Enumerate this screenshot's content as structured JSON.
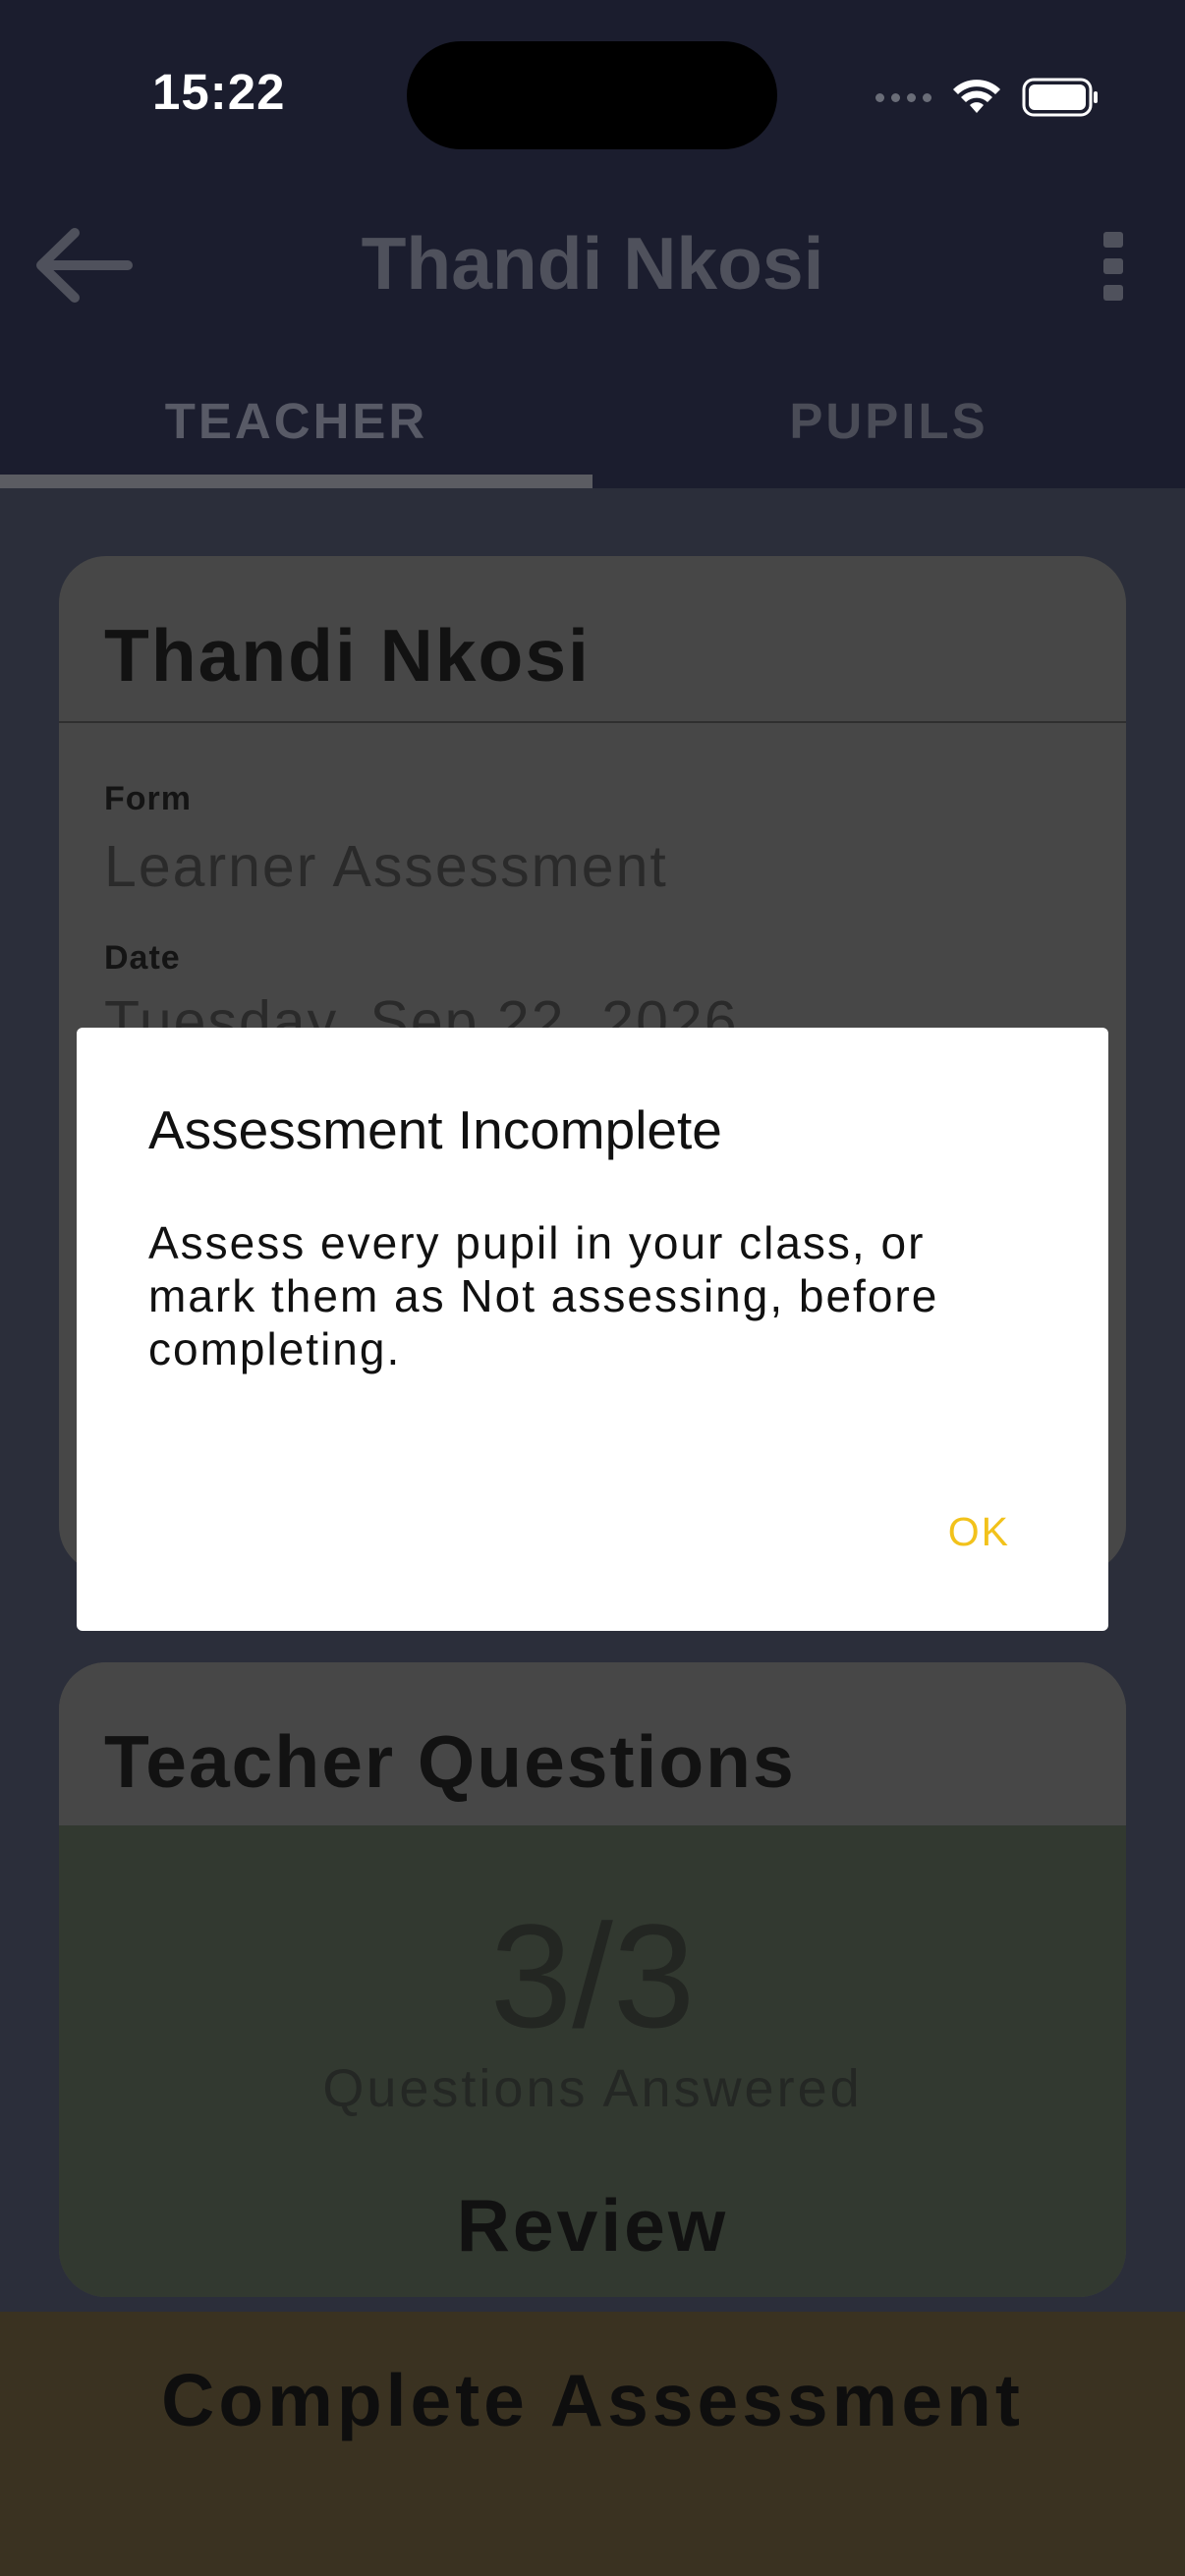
{
  "status_bar": {
    "time": "15:22"
  },
  "header": {
    "title": "Thandi Nkosi",
    "back_icon": "arrow-left-icon",
    "menu_icon": "more-vertical-icon"
  },
  "tabs": [
    {
      "label": "TEACHER",
      "selected": true
    },
    {
      "label": "PUPILS",
      "selected": false
    }
  ],
  "details_card": {
    "title": "Thandi Nkosi",
    "form_label": "Form",
    "form_value": "Learner Assessment",
    "date_label": "Date",
    "date_value": "Tuesday, Sep 22, 2026"
  },
  "questions_card": {
    "title": "Teacher Questions",
    "progress": "3/3",
    "progress_caption": "Questions Answered",
    "review_label": "Review"
  },
  "complete_button": {
    "label": "Complete Assessment"
  },
  "dialog": {
    "title": "Assessment Incomplete",
    "message": "Assess every pupil in your class, or mark them as Not assessing, before completing.",
    "ok_label": "OK"
  },
  "colors": {
    "accent": "#f2c21b",
    "appbar": "#1b1d2e"
  }
}
